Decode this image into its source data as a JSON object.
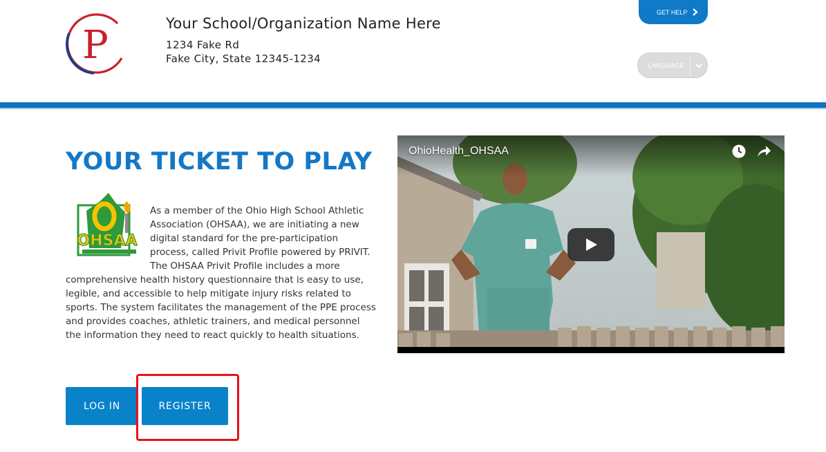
{
  "header": {
    "org_name": "Your School/Organization Name Here",
    "address_line1": "1234 Fake Rd",
    "address_line2": "Fake City, State 12345-1234",
    "get_help_label": "GET HELP",
    "language_label": "LANGUAGE",
    "logo_letter": "P"
  },
  "main": {
    "title": "YOUR TICKET TO PLAY",
    "ohsaa_logo_text": "OHSAA",
    "description": "As a member of the Ohio High School Athletic Association (OHSAA), we are initiating a new digital standard for the pre-participation process, called Privit Profile powered by PRIVIT.  The OHSAA Privit Profile includes a more comprehensive health history questionnaire that is easy to use, legible, and accessible to help mitigate injury risks related to sports. The system facilitates the management of the PPE process and provides coaches, athletic trainers, and medical personnel the information they need to react quickly to health situations.",
    "login_label": "LOG IN",
    "register_label": "REGISTER"
  },
  "video": {
    "title": "OhioHealth_OHSAA",
    "icons": [
      "watch-later-icon",
      "share-icon",
      "play-icon"
    ]
  },
  "colors": {
    "brand_blue": "#0d73bf",
    "button_blue": "#0a82c9",
    "title_blue": "#1578c6",
    "highlight_red": "#e8101c",
    "logo_red": "#c8202c",
    "logo_navy": "#1e3a8a",
    "ohsaa_green": "#2e9a3a",
    "ohsaa_yellow": "#f5c400"
  }
}
